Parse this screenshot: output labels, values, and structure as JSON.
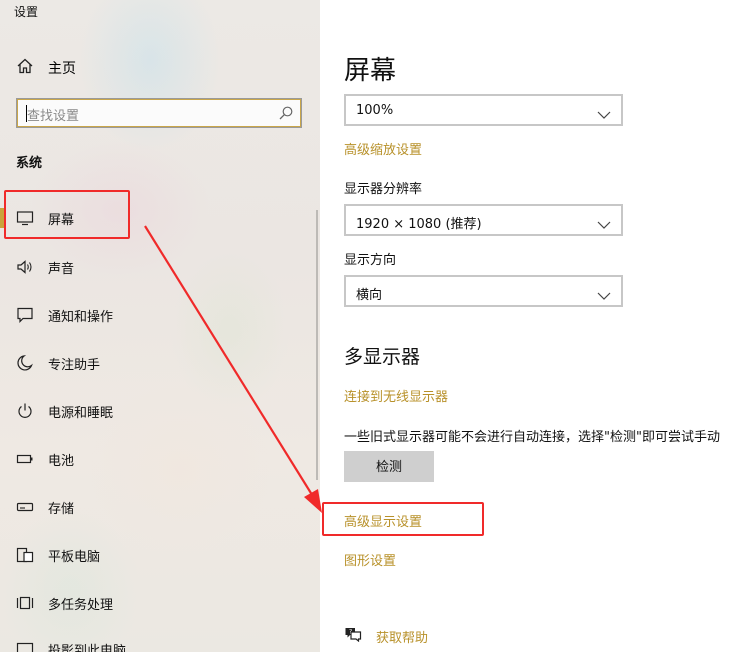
{
  "window": {
    "title": "设置"
  },
  "sidebar": {
    "home_label": "主页",
    "search_placeholder": "查找设置",
    "section_label": "系统",
    "items": [
      {
        "label": "屏幕",
        "icon": "monitor-icon",
        "active": true
      },
      {
        "label": "声音",
        "icon": "speaker-icon"
      },
      {
        "label": "通知和操作",
        "icon": "notification-icon"
      },
      {
        "label": "专注助手",
        "icon": "moon-icon"
      },
      {
        "label": "电源和睡眠",
        "icon": "power-icon"
      },
      {
        "label": "电池",
        "icon": "battery-icon"
      },
      {
        "label": "存储",
        "icon": "storage-icon"
      },
      {
        "label": "平板电脑",
        "icon": "tablet-icon"
      },
      {
        "label": "多任务处理",
        "icon": "multitask-icon"
      },
      {
        "label": "投影到此电脑",
        "icon": "projection-icon"
      }
    ]
  },
  "main": {
    "title": "屏幕",
    "scale_value": "100%",
    "advanced_scaling_link": "高级缩放设置",
    "resolution_label": "显示器分辨率",
    "resolution_value": "1920 × 1080 (推荐)",
    "orientation_label": "显示方向",
    "orientation_value": "横向",
    "multi_display_heading": "多显示器",
    "wireless_link": "连接到无线显示器",
    "detect_description": "一些旧式显示器可能不会进行自动连接，选择\"检测\"即可尝试手动",
    "detect_button": "检测",
    "advanced_display_link": "高级显示设置",
    "graphics_link": "图形设置",
    "help_link": "获取帮助"
  },
  "colors": {
    "accent": "#b8912a",
    "annotation": "#f02a2a"
  }
}
